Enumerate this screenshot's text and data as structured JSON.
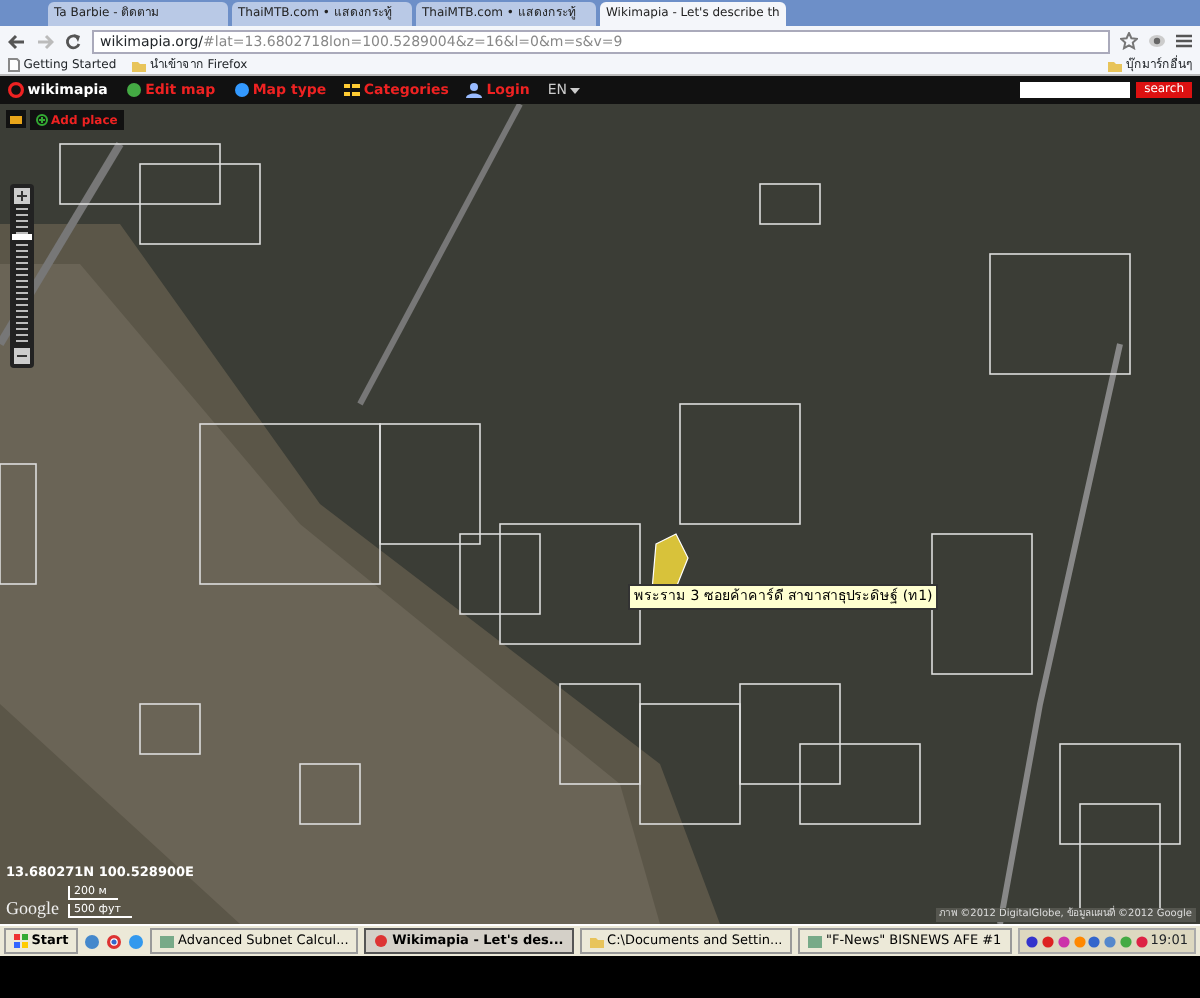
{
  "browser": {
    "tabs": [
      {
        "label": "Ta Barbie - ติดตาม",
        "selected": false
      },
      {
        "label": "ThaiMTB.com • แสดงกระทู้",
        "selected": false
      },
      {
        "label": "ThaiMTB.com • แสดงกระทู้",
        "selected": false
      },
      {
        "label": "Wikimapia - Let's describe th",
        "selected": true
      }
    ],
    "address": {
      "host": "wikimapia.org/",
      "rest": "#lat=13.6802718lon=100.5289004&z=16&l=0&m=s&v=9"
    },
    "bookmarks": [
      "Getting Started",
      "นำเข้าจาก Firefox"
    ],
    "other_bookmarks": "บุ๊กมาร์กอื่นๆ"
  },
  "wikimapia": {
    "logo": "wikimapia",
    "menu": [
      "Edit map",
      "Map type",
      "Categories",
      "Login"
    ],
    "language": "EN",
    "search_button": "search",
    "add_place": "Add place"
  },
  "map": {
    "zoom": {
      "level": 0.8
    },
    "tooltip": "พระราม 3 ซอยค้าคาร์ดี สาขาสาธุประดิษฐ์ (ท1)",
    "coordinates": "13.680271N 100.528900E",
    "google": "Google",
    "scale": [
      "200 м",
      "500 фут"
    ],
    "copyright": "ภาพ ©2012 DigitalGlobe, ข้อมูลแผนที่ ©2012 Google"
  },
  "taskbar": {
    "start": "Start",
    "buttons": [
      {
        "label": "Advanced Subnet Calcul...",
        "selected": false
      },
      {
        "label": "Wikimapia - Let's des...",
        "selected": true
      },
      {
        "label": "C:\\Documents and Settin...",
        "selected": false
      },
      {
        "label": "\"F-News\" BISNEWS AFE #1",
        "selected": false
      }
    ],
    "clock": "19:01"
  }
}
